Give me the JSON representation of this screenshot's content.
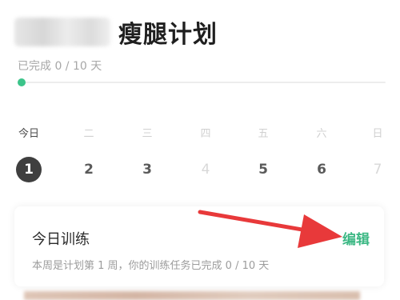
{
  "header": {
    "title": "瘦腿计划"
  },
  "progress": {
    "label": "已完成 0 / 10 天",
    "completed": 0,
    "total": 10
  },
  "week": {
    "days": [
      {
        "label": "今日",
        "num": "1"
      },
      {
        "label": "二",
        "num": "2"
      },
      {
        "label": "三",
        "num": "3"
      },
      {
        "label": "四",
        "num": "4"
      },
      {
        "label": "五",
        "num": "5"
      },
      {
        "label": "六",
        "num": "6"
      },
      {
        "label": "日",
        "num": "7"
      }
    ]
  },
  "training": {
    "title": "今日训练",
    "edit_label": "编辑",
    "subtitle": "本周是计划第 1 周，你的训练任务已完成 0 / 10 天"
  },
  "colors": {
    "accent": "#3cc48a",
    "annotation_arrow": "#e8393a"
  }
}
